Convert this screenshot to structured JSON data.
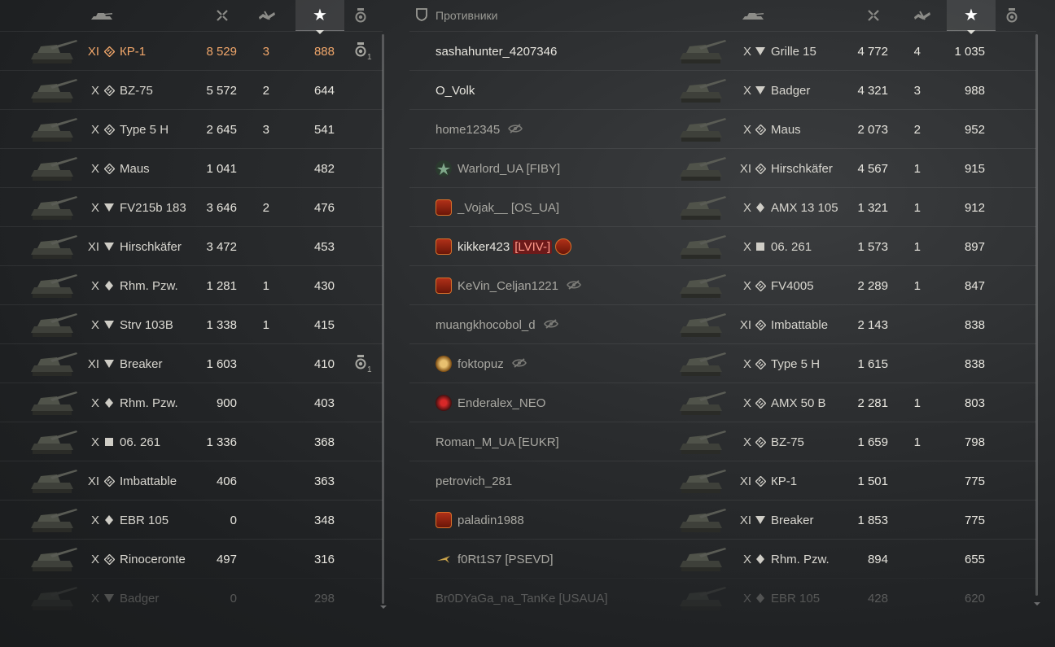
{
  "left": {
    "rows": [
      {
        "tier": "XI",
        "type": "md",
        "vehicle": "КР-1",
        "damage": "8 529",
        "frags": "3",
        "xp": "888",
        "medal": "1",
        "hl": true
      },
      {
        "tier": "X",
        "type": "md",
        "vehicle": "BZ-75",
        "damage": "5 572",
        "frags": "2",
        "xp": "644"
      },
      {
        "tier": "X",
        "type": "md",
        "vehicle": "Type 5 H",
        "damage": "2 645",
        "frags": "3",
        "xp": "541"
      },
      {
        "tier": "X",
        "type": "md",
        "vehicle": "Maus",
        "damage": "1 041",
        "frags": "",
        "xp": "482"
      },
      {
        "tier": "X",
        "type": "td",
        "vehicle": "FV215b 183",
        "damage": "3 646",
        "frags": "2",
        "xp": "476"
      },
      {
        "tier": "XI",
        "type": "td",
        "vehicle": "Hirschkäfer",
        "damage": "3 472",
        "frags": "",
        "xp": "453"
      },
      {
        "tier": "X",
        "type": "lt",
        "vehicle": "Rhm. Pzw.",
        "damage": "1 281",
        "frags": "1",
        "xp": "430"
      },
      {
        "tier": "X",
        "type": "td",
        "vehicle": "Strv 103B",
        "damage": "1 338",
        "frags": "1",
        "xp": "415"
      },
      {
        "tier": "XI",
        "type": "td",
        "vehicle": "Breaker",
        "damage": "1 603",
        "frags": "",
        "xp": "410",
        "medal": "1"
      },
      {
        "tier": "X",
        "type": "lt",
        "vehicle": "Rhm. Pzw.",
        "damage": "900",
        "frags": "",
        "xp": "403"
      },
      {
        "tier": "X",
        "type": "spg",
        "vehicle": "06. 261",
        "damage": "1 336",
        "frags": "",
        "xp": "368"
      },
      {
        "tier": "XI",
        "type": "md",
        "vehicle": "Imbattable",
        "damage": "406",
        "frags": "",
        "xp": "363"
      },
      {
        "tier": "X",
        "type": "lt",
        "vehicle": "EBR 105",
        "damage": "0",
        "frags": "",
        "xp": "348"
      },
      {
        "tier": "X",
        "type": "md",
        "vehicle": "Rinoceronte",
        "damage": "497",
        "frags": "",
        "xp": "316"
      },
      {
        "tier": "X",
        "type": "td",
        "vehicle": "Badger",
        "damage": "0",
        "frags": "",
        "xp": "298",
        "fade": true
      }
    ]
  },
  "right": {
    "title": "Противники",
    "rows": [
      {
        "player": "sashahunter_4207346",
        "tier": "X",
        "type": "td",
        "vehicle": "Grille 15",
        "damage": "4 772",
        "frags": "4",
        "xp": "1 035",
        "bright": true
      },
      {
        "player": "O_Volk",
        "tier": "X",
        "type": "td",
        "vehicle": "Badger",
        "damage": "4 321",
        "frags": "3",
        "xp": "988",
        "bright": true
      },
      {
        "player": "home12345",
        "tier": "X",
        "type": "md",
        "vehicle": "Maus",
        "damage": "2 073",
        "frags": "2",
        "xp": "952",
        "eye": true,
        "muted": true
      },
      {
        "player": "Warlord_UA [FIBY]",
        "tier": "XI",
        "type": "md",
        "vehicle": "Hirschkäfer",
        "damage": "4 567",
        "frags": "1",
        "xp": "915",
        "icon": "star",
        "muted": true
      },
      {
        "player": "_Vojak__ [OS_UA]",
        "tier": "X",
        "type": "lt",
        "vehicle": "AMX 13 105",
        "damage": "1 321",
        "frags": "1",
        "xp": "912",
        "icon": "red",
        "muted": true
      },
      {
        "player": "kikker423",
        "tag": "[LVIV-]",
        "tier": "X",
        "type": "spg",
        "vehicle": "06. 261",
        "damage": "1 573",
        "frags": "1",
        "xp": "897",
        "icon": "red2",
        "bright": true
      },
      {
        "player": "KeVin_Celjan1221",
        "tier": "X",
        "type": "md",
        "vehicle": "FV4005",
        "damage": "2 289",
        "frags": "1",
        "xp": "847",
        "icon": "red",
        "eye": true,
        "muted": true
      },
      {
        "player": "muangkhocobol_d",
        "tier": "XI",
        "type": "md",
        "vehicle": "Imbattable",
        "damage": "2 143",
        "frags": "",
        "xp": "838",
        "eye": true,
        "muted": true
      },
      {
        "player": "foktopuz",
        "tier": "X",
        "type": "md",
        "vehicle": "Type 5 H",
        "damage": "1 615",
        "frags": "",
        "xp": "838",
        "icon": "coin",
        "eye": true,
        "muted": true
      },
      {
        "player": "Enderalex_NEO",
        "tier": "X",
        "type": "md",
        "vehicle": "AMX 50 B",
        "damage": "2 281",
        "frags": "1",
        "xp": "803",
        "icon": "dark",
        "muted": true
      },
      {
        "player": "Roman_M_UA [EUKR]",
        "tier": "X",
        "type": "md",
        "vehicle": "BZ-75",
        "damage": "1 659",
        "frags": "1",
        "xp": "798",
        "muted": true
      },
      {
        "player": "petrovich_281",
        "tier": "XI",
        "type": "md",
        "vehicle": "КР-1",
        "damage": "1 501",
        "frags": "",
        "xp": "775",
        "muted": true
      },
      {
        "player": "paladin1988",
        "tier": "XI",
        "type": "td",
        "vehicle": "Breaker",
        "damage": "1 853",
        "frags": "",
        "xp": "775",
        "icon": "red",
        "muted": true
      },
      {
        "player": "f0Rt1S7 [PSEVD]",
        "tier": "X",
        "type": "lt",
        "vehicle": "Rhm. Pzw.",
        "damage": "894",
        "frags": "",
        "xp": "655",
        "icon": "plane",
        "muted": true
      },
      {
        "player": "Br0DYaGa_na_TanKe [USAUA]",
        "tier": "X",
        "type": "lt",
        "vehicle": "EBR 105",
        "damage": "428",
        "frags": "",
        "xp": "620",
        "fade": true
      }
    ]
  },
  "colors": {
    "highlight": "#f0a66a",
    "text": "#e8e6df",
    "muted": "#a9a8a2",
    "headerActive": "#ffffff"
  }
}
